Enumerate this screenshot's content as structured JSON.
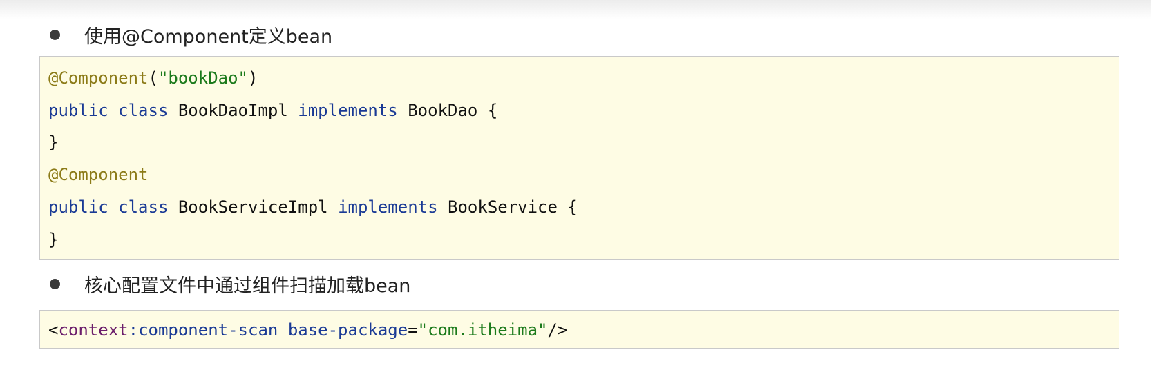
{
  "bullets": [
    {
      "text": "使用@Component定义bean"
    },
    {
      "text": "核心配置文件中通过组件扫描加载bean"
    }
  ],
  "code_block_1": {
    "line1": {
      "annotation": "@Component",
      "open_paren": "(",
      "string": "\"bookDao\"",
      "close_paren": ")"
    },
    "line2": {
      "kw1": "public",
      "kw2": "class",
      "name": "BookDaoImpl",
      "kw3": "implements",
      "iface": "BookDao",
      "brace": "{"
    },
    "line3": {
      "brace": "}"
    },
    "line4": {
      "annotation": "@Component"
    },
    "line5": {
      "kw1": "public",
      "kw2": "class",
      "name": "BookServiceImpl",
      "kw3": "implements",
      "iface": "BookService",
      "brace": "{"
    },
    "line6": {
      "brace": "}"
    }
  },
  "code_block_2": {
    "line1": {
      "lt": "<",
      "prefix": "context",
      "colon": ":",
      "element": "component-scan",
      "attr": "base-package",
      "eq": "=",
      "value": "\"com.itheima\"",
      "end": "/>"
    }
  },
  "colors": {
    "code_background": "#fefce4",
    "annotation": "#8c7b18",
    "string": "#1b7a1b",
    "keyword": "#1a3a95",
    "xml_prefix": "#6b1d6b"
  }
}
